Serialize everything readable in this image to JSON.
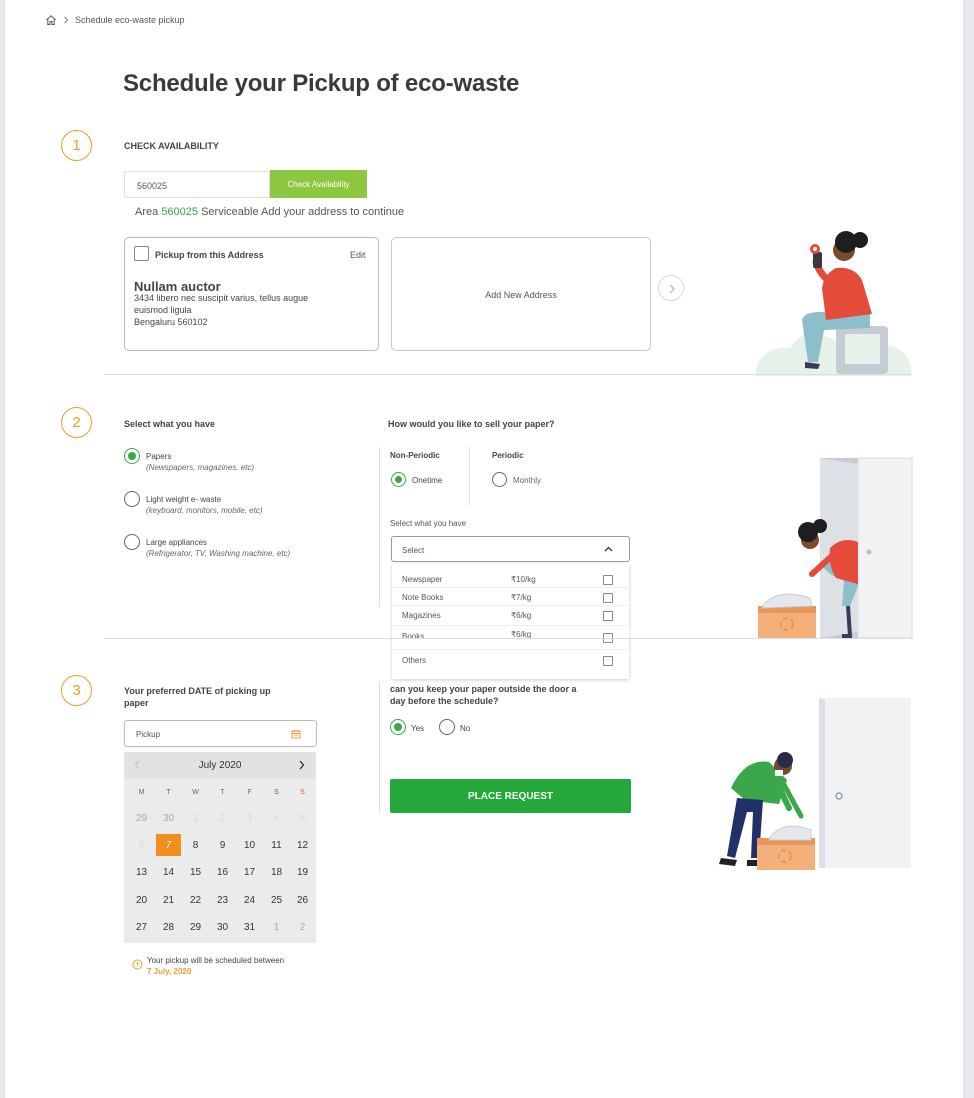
{
  "breadcrumb": {
    "current": "Schedule eco-waste pickup"
  },
  "page_title": "Schedule your Pickup of eco-waste",
  "step1": {
    "number": "1",
    "title": "CHECK AVAILABILITY",
    "pincode_value": "560025",
    "check_button": "Check Availability",
    "area_prefix": "Area",
    "area_code": "560025",
    "area_suffix": "Serviceable Add your address to continue",
    "address_card": {
      "checkbox_label": "Pickup from this Address",
      "edit": "Edit",
      "name": "Nullam auctor",
      "line1": "3434 libero nec suscipit varius, tellus augue",
      "line2": "euismod ligula",
      "line3": "Bengaluru 560102"
    },
    "add_new": "Add New Address"
  },
  "step2": {
    "number": "2",
    "title": "Select what you have",
    "options": [
      {
        "title": "Papers",
        "sub": "(Newspapers, magazines, etc)",
        "selected": true
      },
      {
        "title": "Light weight e- waste",
        "sub": "(keyboard, monitors, mobile, etc)",
        "selected": false
      },
      {
        "title": "Large appliances",
        "sub": "(Refrigerator, TV, Washing machine, etc)",
        "selected": false
      }
    ],
    "sell_title": "How would you like to sell your paper?",
    "non_periodic": "Non-Periodic",
    "periodic": "Periodic",
    "onetime": "Onetime",
    "monthly": "Monthly",
    "select_label": "Select what you have",
    "select_placeholder": "Select",
    "dropdown": [
      {
        "name": "Newspaper",
        "price": "₹10/kg"
      },
      {
        "name": "Note Books",
        "price": "₹7/kg"
      },
      {
        "name": "Magazines",
        "price": "₹6/kg"
      },
      {
        "name": "Books",
        "price": "₹6/kg"
      },
      {
        "name": "Others",
        "price": ""
      }
    ]
  },
  "step3": {
    "number": "3",
    "date_title_1": "Your preferred DATE of picking up",
    "date_title_2": "paper",
    "pickup_placeholder": "Pickup",
    "calendar": {
      "month": "July 2020",
      "dow": [
        "M",
        "T",
        "W",
        "T",
        "F",
        "S",
        "S"
      ],
      "weeks": [
        [
          "29",
          "30",
          "1",
          "2",
          "3",
          "4",
          "5"
        ],
        [
          "6",
          "7",
          "8",
          "9",
          "10",
          "11",
          "12"
        ],
        [
          "13",
          "14",
          "15",
          "16",
          "17",
          "18",
          "19"
        ],
        [
          "20",
          "21",
          "22",
          "23",
          "24",
          "25",
          "26"
        ],
        [
          "27",
          "28",
          "29",
          "30",
          "31",
          "1",
          "2"
        ]
      ],
      "selected": "7"
    },
    "note": "Your pickup will be scheduled between",
    "note_date": "7 July, 2020",
    "question_1": "can you keep your paper outside the door a",
    "question_2": "day before the schedule?",
    "yes": "Yes",
    "no": "No",
    "place_request": "PLACE REQUEST"
  },
  "colors": {
    "accent_orange": "#f29a2e",
    "green": "#22a93a",
    "light_green": "#8dc63f"
  }
}
